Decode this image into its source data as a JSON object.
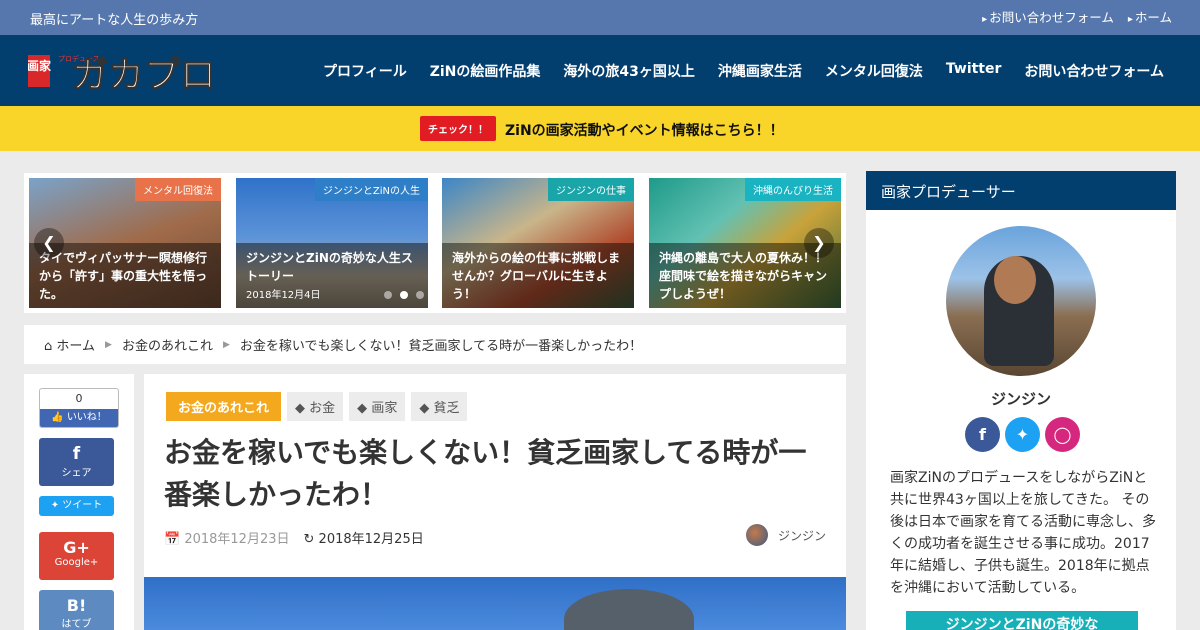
{
  "topbar": {
    "tagline": "最高にアートな人生の歩み方",
    "links": [
      "お問い合わせフォーム",
      "ホーム"
    ]
  },
  "header": {
    "logo_text": "ガカプロ",
    "logo_kanji": "画家",
    "logo_small": "プロデュース",
    "nav": [
      "プロフィール",
      "ZiNの絵画作品集",
      "海外の旅43ヶ国以上",
      "沖縄画家生活",
      "メンタル回復法",
      "Twitter",
      "お問い合わせフォーム"
    ]
  },
  "notice": {
    "badge": "チェック！！",
    "text": "ZiNの画家活動やイベント情報はこちら！！"
  },
  "carousel": {
    "slides": [
      {
        "category": "メンタル回復法",
        "title": "タイでヴィパッサナー瞑想修行から「許す」事の重大性を悟った。",
        "date": ""
      },
      {
        "category": "ジンジンとZiNの人生",
        "title": "ジンジンとZiNの奇妙な人生ストーリー",
        "date": "2018年12月4日"
      },
      {
        "category": "ジンジンの仕事",
        "title": "海外からの絵の仕事に挑戦しませんか？グローバルに生きよう！",
        "date": ""
      },
      {
        "category": "沖縄のんびり生活",
        "title": "沖縄の離島で大人の夏休み！！座間味で絵を描きながらキャンプしようぜ！",
        "date": ""
      }
    ],
    "colors": [
      "#e8734a",
      "#2f7fc8",
      "#1aa6a8",
      "#19b3c2"
    ]
  },
  "breadcrumb": {
    "home": "ホーム",
    "category": "お金のあれこれ",
    "current": "お金を稼いでも楽しくない！貧乏画家してる時が一番楽しかったわ！"
  },
  "share": {
    "like_count": "0",
    "like_label": "いいね！",
    "facebook": "シェア",
    "twitter": "ツイート",
    "google": "Google+",
    "hatena": "はてブ"
  },
  "article": {
    "main_category": "お金のあれこれ",
    "tags": [
      "お金",
      "画家",
      "貧乏"
    ],
    "title": "お金を稼いでも楽しくない！貧乏画家してる時が一番楽しかったわ！",
    "published": "2018年12月23日",
    "updated": "2018年12月25日",
    "author": "ジンジン"
  },
  "sidebar": {
    "heading": "画家プロデューサー",
    "name": "ジンジン",
    "bio": "画家ZiNのプロデュースをしながらZiNと共に世界43ヶ国以上を旅してきた。 その後は日本で画家を育てる活動に専念し、多くの成功者を誕生させる事に成功。2017年に結婚し、子供も誕生。2018年に拠点を沖縄において活動している。",
    "button": "ジンジンとZiNの奇妙な"
  }
}
